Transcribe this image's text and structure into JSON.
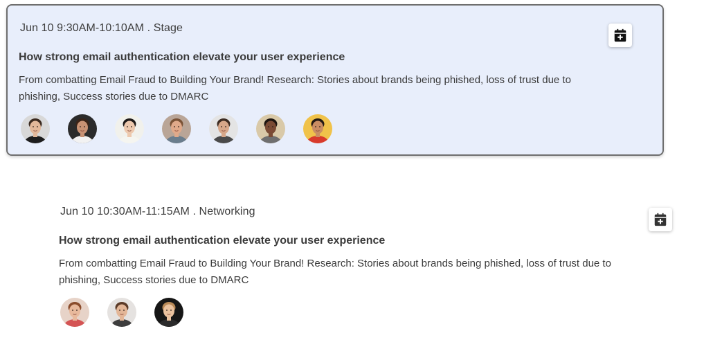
{
  "sessions": [
    {
      "meta": "Jun 10 9:30AM-10:10AM . Stage",
      "title": "How strong email authentication elevate your user experience",
      "description": "From combatting Email Fraud to Building Your Brand! Research: Stories about brands being phished, loss of trust due to phishing, Success stories due to DMARC",
      "calendar_icon": "calendar-plus-icon",
      "speakers": [
        {
          "bg": "#d8d8d8",
          "skin": "#e2b89a",
          "hair": "#3b2a20",
          "shirt": "#1d1d1d"
        },
        {
          "bg": "#2b2b2b",
          "skin": "#c89274",
          "hair": "#3a2418",
          "shirt": "#f2f2f2"
        },
        {
          "bg": "#f1f1ec",
          "skin": "#edc9ae",
          "hair": "#1e1a18",
          "shirt": "#f5f5f0"
        },
        {
          "bg": "#b9a597",
          "skin": "#e0a98a",
          "hair": "#7a5236",
          "shirt": "#6a7d8d"
        },
        {
          "bg": "#e4e4e4",
          "skin": "#d7a789",
          "hair": "#3d2c22",
          "shirt": "#4a4a4a"
        },
        {
          "bg": "#d9c9a8",
          "skin": "#7a4b34",
          "hair": "#1d1510",
          "shirt": "#6f6f6f"
        },
        {
          "bg": "#f0c24a",
          "skin": "#c98d63",
          "hair": "#231a14",
          "shirt": "#d83a2c"
        }
      ]
    },
    {
      "meta": "Jun 10 10:30AM-11:15AM . Networking",
      "title": "How strong email authentication elevate your user experience",
      "description": "From combatting Email Fraud to Building Your Brand! Research: Stories about brands being phished, loss of trust due to phishing, Success stories due to DMARC",
      "calendar_icon": "calendar-plus-icon",
      "speakers": [
        {
          "bg": "#e7d3c8",
          "skin": "#e8b99c",
          "hair": "#8a4c2c",
          "shirt": "#d45454"
        },
        {
          "bg": "#e5e2e0",
          "skin": "#e3b697",
          "hair": "#5b3a27",
          "shirt": "#3d3d3d"
        },
        {
          "bg": "#161616",
          "skin": "#eac29f",
          "hair": "#b98a58",
          "shirt": "#2b2b2b"
        }
      ]
    }
  ]
}
